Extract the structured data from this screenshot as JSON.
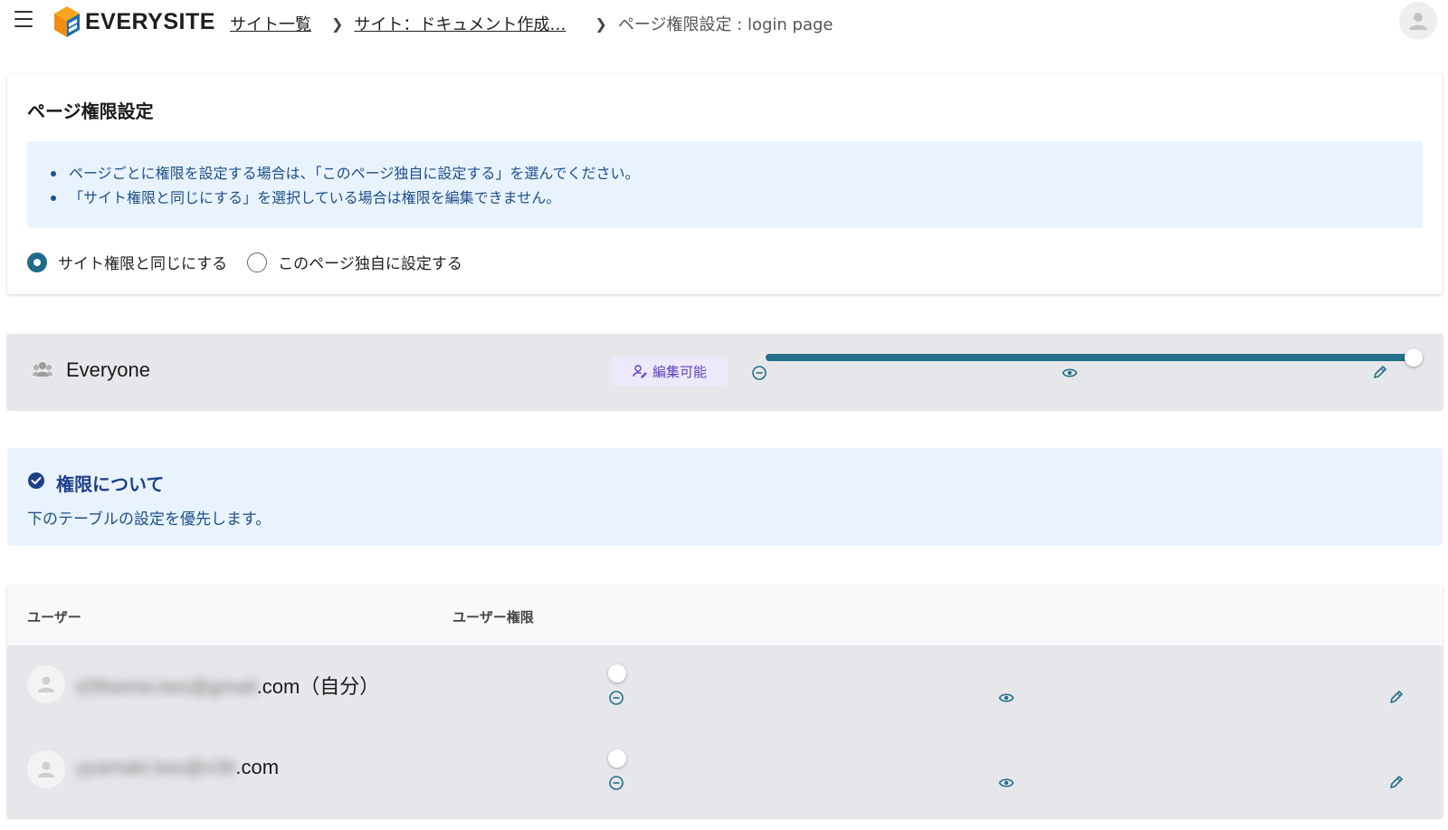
{
  "header": {
    "logo_text": "EVERYSITE",
    "breadcrumbs": [
      {
        "label": "サイト一覧"
      },
      {
        "label": "サイト：ドキュメント作成…"
      }
    ],
    "current_page": "ページ権限設定 : login page"
  },
  "settings": {
    "title": "ページ権限設定",
    "info": [
      "ページごとに権限を設定する場合は、「このページ独自に設定する」を選んでください。",
      "「サイト権限と同じにする」を選択している場合は権限を編集できません。"
    ],
    "options": [
      {
        "label": "サイト権限と同じにする",
        "checked": true
      },
      {
        "label": "このページ独自に設定する",
        "checked": false
      }
    ]
  },
  "everyone": {
    "name": "Everyone",
    "badge": "編集可能",
    "level": 1.0
  },
  "about": {
    "title": "権限について",
    "description": "下のテーブルの設定を優先します。"
  },
  "users": {
    "columns": [
      "ユーザー",
      "ユーザー権限"
    ],
    "rows": [
      {
        "email_hidden": "d3fweriw.tws@gmail",
        "email_visible": ".com（自分）",
        "level": 0
      },
      {
        "email_hidden": "yyamaki.tws@s3it",
        "email_visible": ".com",
        "level": 0
      }
    ]
  },
  "colors": {
    "accent": "#246f8a",
    "info_bg": "#e8f3fe",
    "badge_text": "#5b3fc2",
    "about_title": "#1f3f8a"
  },
  "icons": [
    "menu-icon",
    "logo-icon",
    "avatar-icon",
    "group-icon",
    "edit-user-icon",
    "minus-circle-icon",
    "eye-icon",
    "pencil-icon",
    "check-circle-icon",
    "user-icon"
  ]
}
